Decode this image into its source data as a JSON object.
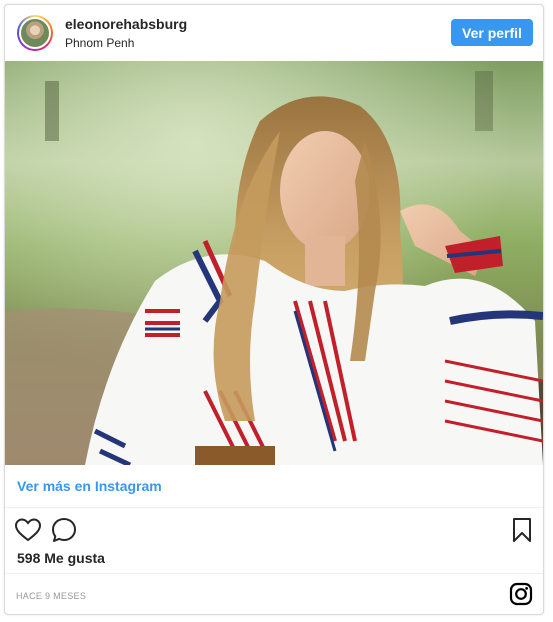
{
  "post": {
    "username": "eleonorehabsburg",
    "location": "Phnom Penh",
    "profile_button": "Ver perfil",
    "more_link": "Ver más en Instagram",
    "likes": "598 Me gusta",
    "timestamp": "HACE 9 MESES"
  },
  "icons": {
    "avatar": "profile-avatar",
    "like": "heart-icon",
    "comment": "comment-bubble-icon",
    "save": "bookmark-icon",
    "brand": "instagram-icon"
  },
  "colors": {
    "accent": "#3897f0",
    "text": "#262626",
    "muted": "#999999",
    "border": "#dbdbdb"
  }
}
